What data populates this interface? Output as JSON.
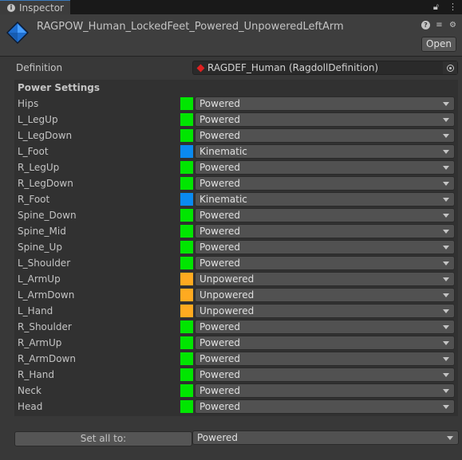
{
  "tab": {
    "label": "Inspector"
  },
  "header": {
    "asset_name": "RAGPOW_Human_LockedFeet_Powered_UnpoweredLeftArm",
    "open_label": "Open"
  },
  "definition": {
    "label": "Definition",
    "value": "RAGDEF_Human (RagdollDefinition)"
  },
  "power_settings": {
    "title": "Power Settings",
    "colors": {
      "Powered": "#00e600",
      "Kinematic": "#0a8af0",
      "Unpowered": "#ffaa20"
    },
    "rows": [
      {
        "bone": "Hips",
        "mode": "Powered"
      },
      {
        "bone": "L_LegUp",
        "mode": "Powered"
      },
      {
        "bone": "L_LegDown",
        "mode": "Powered"
      },
      {
        "bone": "L_Foot",
        "mode": "Kinematic"
      },
      {
        "bone": "R_LegUp",
        "mode": "Powered"
      },
      {
        "bone": "R_LegDown",
        "mode": "Powered"
      },
      {
        "bone": "R_Foot",
        "mode": "Kinematic"
      },
      {
        "bone": "Spine_Down",
        "mode": "Powered"
      },
      {
        "bone": "Spine_Mid",
        "mode": "Powered"
      },
      {
        "bone": "Spine_Up",
        "mode": "Powered"
      },
      {
        "bone": "L_Shoulder",
        "mode": "Powered"
      },
      {
        "bone": "L_ArmUp",
        "mode": "Unpowered"
      },
      {
        "bone": "L_ArmDown",
        "mode": "Unpowered"
      },
      {
        "bone": "L_Hand",
        "mode": "Unpowered"
      },
      {
        "bone": "R_Shoulder",
        "mode": "Powered"
      },
      {
        "bone": "R_ArmUp",
        "mode": "Powered"
      },
      {
        "bone": "R_ArmDown",
        "mode": "Powered"
      },
      {
        "bone": "R_Hand",
        "mode": "Powered"
      },
      {
        "bone": "Neck",
        "mode": "Powered"
      },
      {
        "bone": "Head",
        "mode": "Powered"
      }
    ]
  },
  "set_all": {
    "button_label": "Set all to:",
    "value": "Powered"
  }
}
